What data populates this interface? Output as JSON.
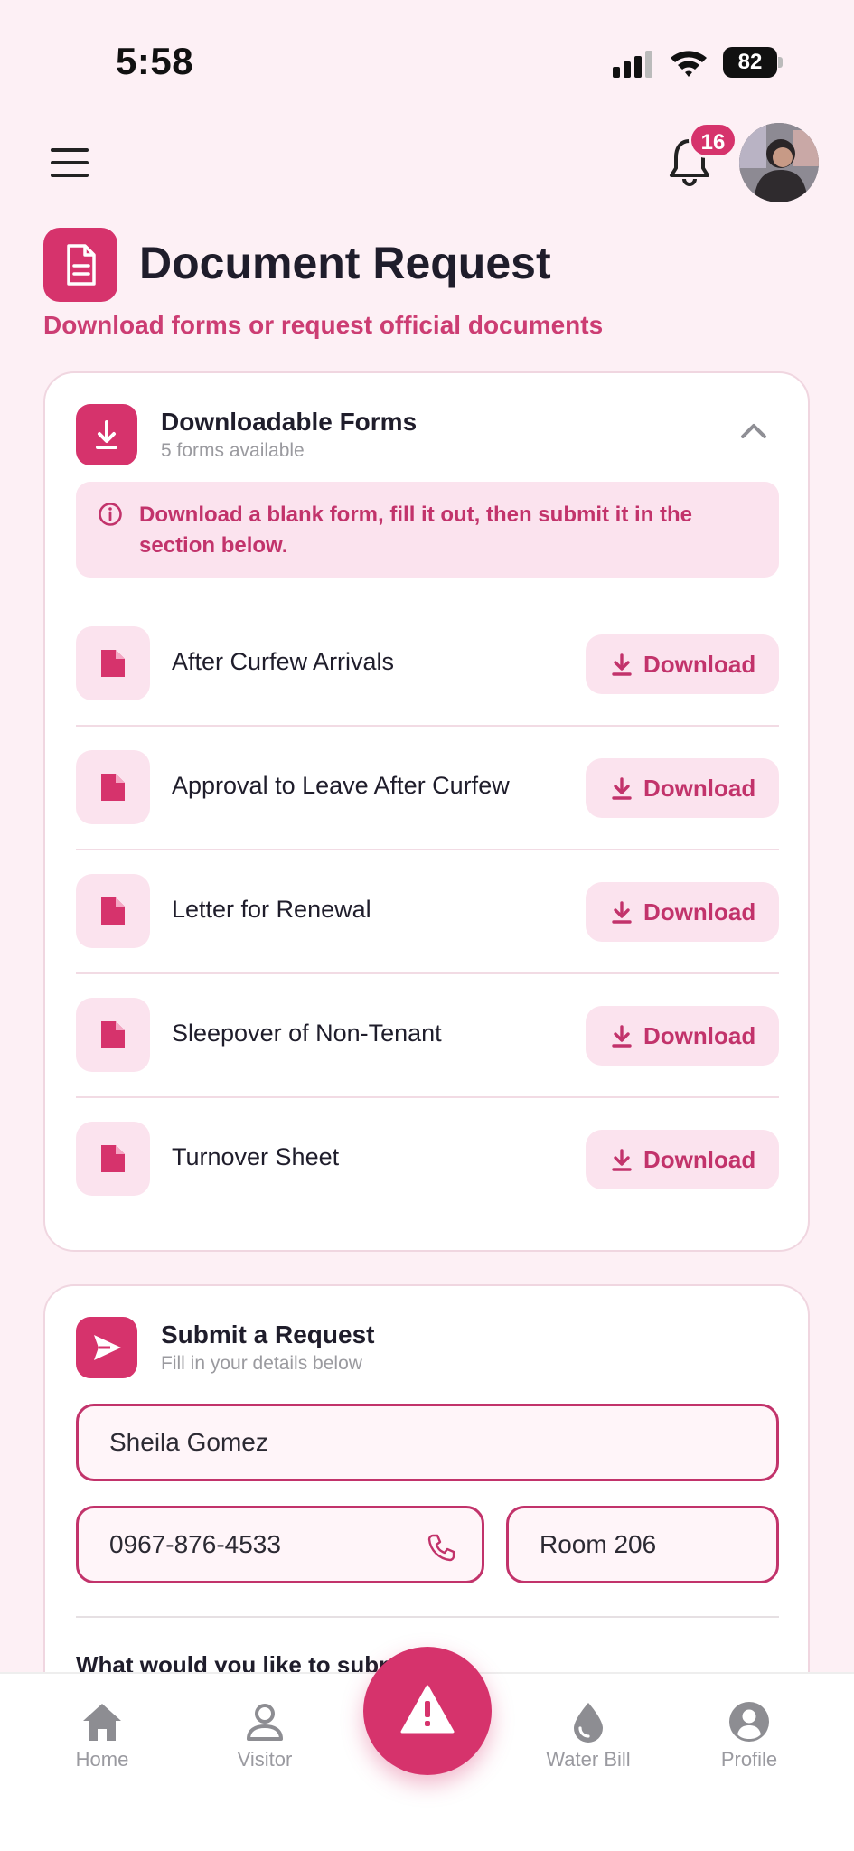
{
  "status_bar": {
    "time": "5:58",
    "battery": "82"
  },
  "header": {
    "notification_count": "16"
  },
  "page": {
    "title": "Document Request",
    "subtitle": "Download forms or request official documents"
  },
  "forms_card": {
    "title": "Downloadable Forms",
    "subtitle": "5 forms available",
    "info": "Download a blank form, fill it out, then submit it in the section below.",
    "download_label": "Download",
    "items": [
      {
        "name": "After Curfew Arrivals"
      },
      {
        "name": "Approval to Leave After Curfew"
      },
      {
        "name": "Letter for Renewal"
      },
      {
        "name": "Sleepover of Non-Tenant"
      },
      {
        "name": "Turnover Sheet"
      }
    ]
  },
  "submit_card": {
    "title": "Submit a Request",
    "subtitle": "Fill in your details below",
    "name_value": "Sheila Gomez",
    "phone_value": "0967-876-4533",
    "room_value": "Room 206",
    "question": "What would you like to subm"
  },
  "bottom_nav": {
    "items": [
      {
        "label": "Home",
        "icon": "home-icon"
      },
      {
        "label": "Visitor",
        "icon": "user-icon"
      },
      {
        "label": "Water Bill",
        "icon": "water-drop-icon"
      },
      {
        "label": "Profile",
        "icon": "profile-icon"
      }
    ],
    "center": {
      "icon": "alert-triangle-icon"
    }
  },
  "colors": {
    "accent": "#d6336c",
    "accent_text": "#c2336b",
    "background": "#fdf0f5",
    "tint": "#fbe3ee"
  }
}
